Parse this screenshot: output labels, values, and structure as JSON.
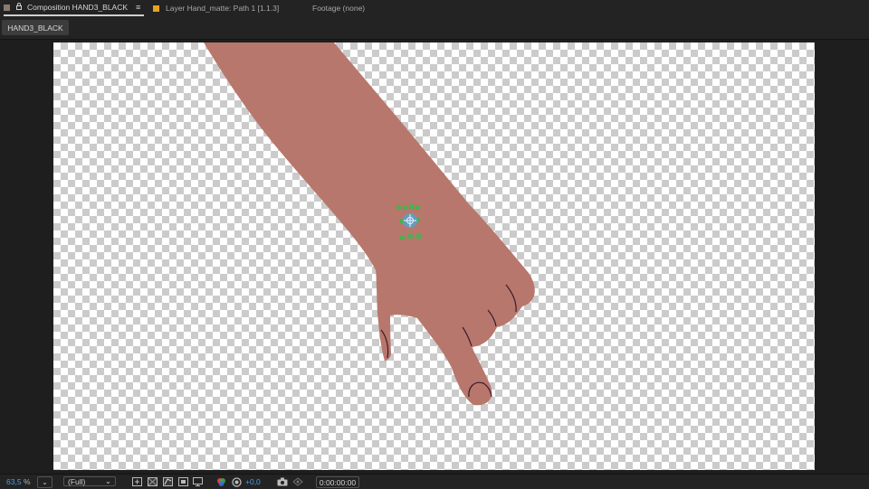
{
  "panel_tabs": {
    "composition": {
      "label": "Composition HAND3_BLACK",
      "swatch_color": "#8a7b6f"
    },
    "layer": {
      "label": "Layer Hand_matte: Path 1 [1.1.3]",
      "swatch_color": "#e8a021"
    },
    "footage": {
      "label": "Footage (none)"
    }
  },
  "composition_chip": {
    "label": "HAND3_BLACK"
  },
  "viewer": {
    "background_color": "#1e1e1e",
    "hand_color": "#b8776c",
    "line_color": "#3a1a2e",
    "handle_color": "#4caf50",
    "anchor_color": "#4aa8d8"
  },
  "bottom_toolbar": {
    "zoom_value": "63,5",
    "zoom_unit": "%",
    "resolution": "(Full)",
    "exposure": "+0,0",
    "timecode": "0:00:00:00",
    "icons": [
      "snapshot-region-icon",
      "transparency-grid-icon",
      "mask-visibility-icon",
      "safe-margins-icon",
      "grid-guide-icon",
      "color-channels-icon",
      "color-management-icon",
      "camera-snapshot-icon",
      "show-snapshot-icon"
    ]
  }
}
